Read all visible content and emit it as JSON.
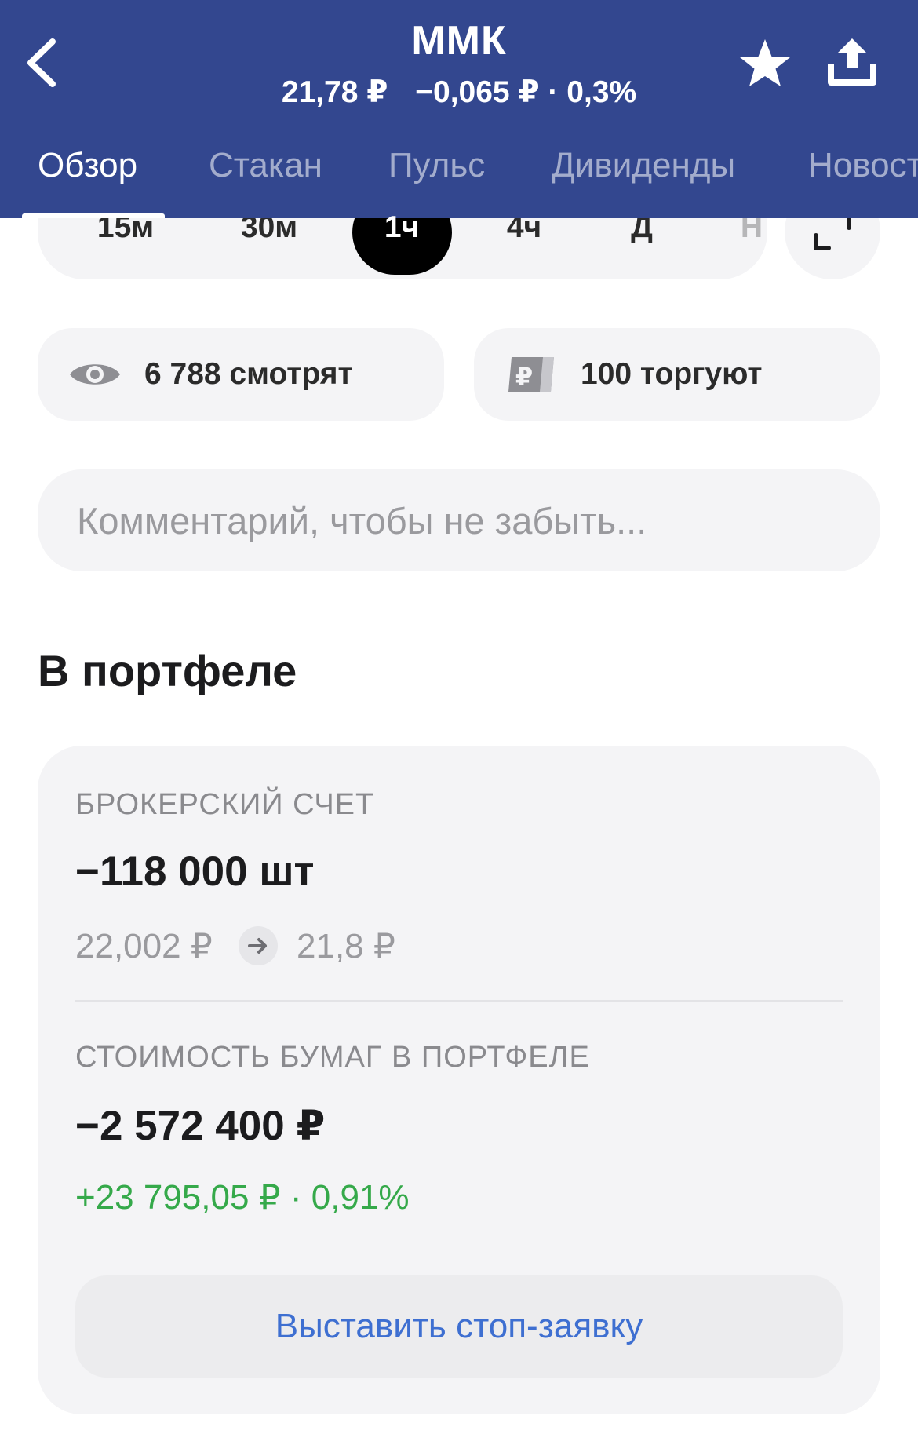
{
  "header": {
    "ticker": "ММК",
    "price": "21,78 ₽",
    "change": "−0,065 ₽ · 0,3%",
    "icons": {
      "back": "chevron-left-icon",
      "favorite": "star-icon",
      "share": "share-upload-icon"
    }
  },
  "tabs": [
    {
      "label": "Обзор",
      "active": true
    },
    {
      "label": "Стакан"
    },
    {
      "label": "Пульс"
    },
    {
      "label": "Дивиденды"
    },
    {
      "label": "Новост"
    }
  ],
  "periods": [
    {
      "label": "15м"
    },
    {
      "label": "30м"
    },
    {
      "label": "1ч",
      "active": true
    },
    {
      "label": "4ч"
    },
    {
      "label": "Д"
    },
    {
      "label": "Н"
    }
  ],
  "stats": {
    "watching": "6 788 смотрят",
    "trading": "100 торгуют"
  },
  "comment": {
    "placeholder": "Комментарий, чтобы не забыть..."
  },
  "portfolio": {
    "title": "В портфеле",
    "account_label": "БРОКЕРСКИЙ СЧЕТ",
    "quantity": "−118 000 шт",
    "avg_price": "22,002 ₽",
    "current_price": "21,8 ₽",
    "value_label": "СТОИМОСТЬ БУМАГ В ПОРТФЕЛЕ",
    "value": "−2 572 400 ₽",
    "profit": "+23 795,05 ₽ · 0,91%",
    "stop_button": "Выставить стоп-заявку"
  },
  "colors": {
    "header_bg": "#33478f",
    "profit_green": "#35a94a",
    "link_blue": "#3e6fd1"
  }
}
